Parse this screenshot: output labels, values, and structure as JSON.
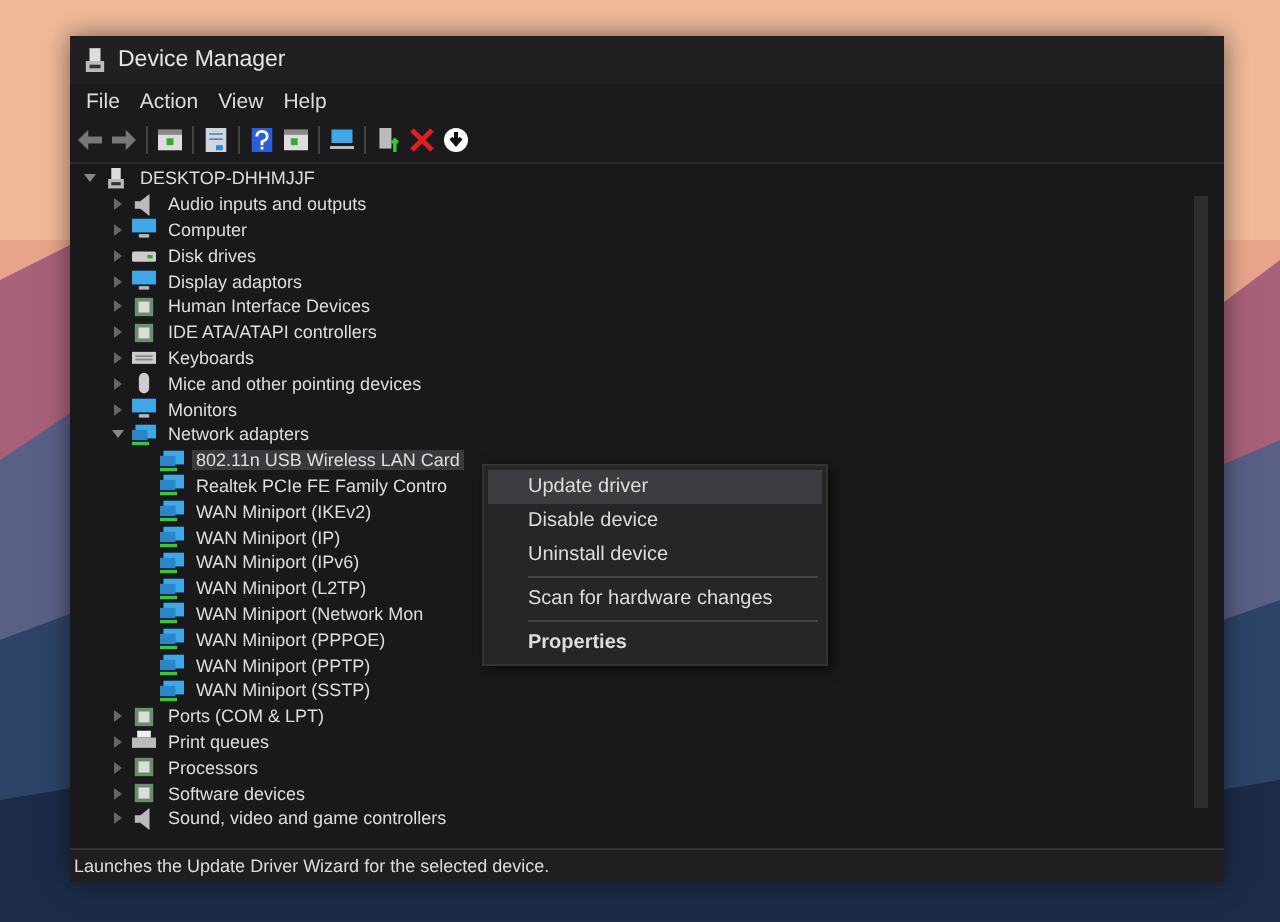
{
  "window": {
    "title": "Device Manager"
  },
  "menu": [
    {
      "label": "File"
    },
    {
      "label": "Action"
    },
    {
      "label": "View"
    },
    {
      "label": "Help"
    }
  ],
  "tree": {
    "label": "DESKTOP-DHHMJJF",
    "expanded": true,
    "children": [
      {
        "label": "Audio inputs and outputs",
        "expanded": false
      },
      {
        "label": "Computer",
        "expanded": false
      },
      {
        "label": "Disk drives",
        "expanded": false
      },
      {
        "label": "Display adaptors",
        "expanded": false
      },
      {
        "label": "Human Interface Devices",
        "expanded": false
      },
      {
        "label": "IDE ATA/ATAPI controllers",
        "expanded": false
      },
      {
        "label": "Keyboards",
        "expanded": false
      },
      {
        "label": "Mice and other pointing devices",
        "expanded": false
      },
      {
        "label": "Monitors",
        "expanded": false
      },
      {
        "label": "Network adapters",
        "expanded": true,
        "children": [
          {
            "label": "802.11n USB Wireless LAN Card",
            "selected": true
          },
          {
            "label": "Realtek PCIe FE Family Contro",
            "selected": false
          },
          {
            "label": "WAN Miniport (IKEv2)",
            "selected": false
          },
          {
            "label": "WAN Miniport (IP)",
            "selected": false
          },
          {
            "label": "WAN Miniport (IPv6)",
            "selected": false
          },
          {
            "label": "WAN Miniport (L2TP)",
            "selected": false
          },
          {
            "label": "WAN Miniport (Network Mon",
            "selected": false
          },
          {
            "label": "WAN Miniport (PPPOE)",
            "selected": false
          },
          {
            "label": "WAN Miniport (PPTP)",
            "selected": false
          },
          {
            "label": "WAN Miniport (SSTP)",
            "selected": false
          }
        ]
      },
      {
        "label": "Ports (COM & LPT)",
        "expanded": false
      },
      {
        "label": "Print queues",
        "expanded": false
      },
      {
        "label": "Processors",
        "expanded": false
      },
      {
        "label": "Software devices",
        "expanded": false
      },
      {
        "label": "Sound, video and game controllers",
        "expanded": false
      }
    ]
  },
  "context_menu": [
    {
      "kind": "item",
      "label": "Update driver",
      "selected": true,
      "default": false
    },
    {
      "kind": "item",
      "label": "Disable device",
      "selected": false,
      "default": false
    },
    {
      "kind": "item",
      "label": "Uninstall device",
      "selected": false,
      "default": false
    },
    {
      "kind": "separator"
    },
    {
      "kind": "item",
      "label": "Scan for hardware changes",
      "selected": false,
      "default": false
    },
    {
      "kind": "separator"
    },
    {
      "kind": "item",
      "label": "Properties",
      "selected": false,
      "default": true
    }
  ],
  "status_bar": {
    "text": "Launches the Update Driver Wizard for the selected device."
  }
}
